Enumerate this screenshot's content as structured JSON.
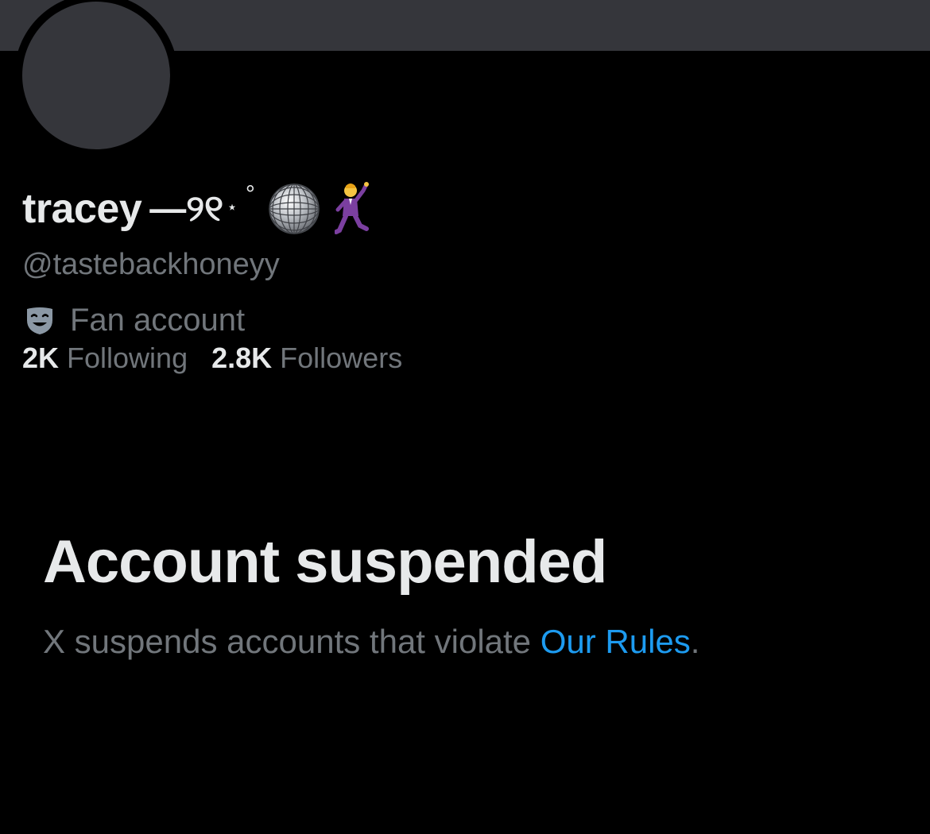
{
  "profile": {
    "display_name": "tracey",
    "name_decoration": "—୨୧",
    "star_decoration": "⋆",
    "ring_decoration": "°",
    "emoji_1": "disco-ball-icon",
    "emoji_2": "man-dancing-icon",
    "handle": "@tastebackhoneyy",
    "category_icon": "performing-arts-mask-icon",
    "category": "Fan account",
    "following_count": "2K",
    "following_label": "Following",
    "followers_count": "2.8K",
    "followers_label": "Followers"
  },
  "suspension": {
    "title": "Account suspended",
    "message_prefix": "X suspends accounts that violate ",
    "rules_link": "Our Rules",
    "message_suffix": "."
  },
  "colors": {
    "background": "#000000",
    "banner": "#35363b",
    "primary_text": "#e7e9ea",
    "secondary_text": "#71767b",
    "link": "#1d9bf0"
  }
}
